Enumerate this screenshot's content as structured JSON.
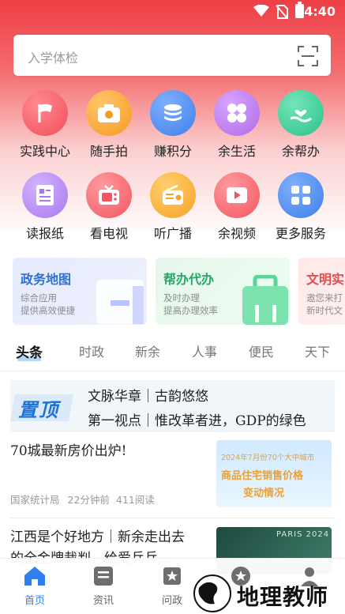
{
  "status_bar": {
    "time": "4:40"
  },
  "search": {
    "placeholder": "入学体检"
  },
  "grid": {
    "row1": [
      {
        "label": "实践中心",
        "icon": "flag-icon",
        "color": "#f24e5a"
      },
      {
        "label": "随手拍",
        "icon": "camera-icon",
        "color": "#f79a21"
      },
      {
        "label": "赚积分",
        "icon": "coins-icon",
        "color": "#3f7fe6"
      },
      {
        "label": "余生活",
        "icon": "clover-icon",
        "color": "#b06ae6"
      },
      {
        "label": "余帮办",
        "icon": "helping-hand-icon",
        "color": "#2cc28a"
      }
    ],
    "row2": [
      {
        "label": "读报纸",
        "icon": "newspaper-icon",
        "color": "#a879ee"
      },
      {
        "label": "看电视",
        "icon": "tv-icon",
        "color": "#f2565e"
      },
      {
        "label": "听广播",
        "icon": "radio-icon",
        "color": "#f6a226"
      },
      {
        "label": "余视频",
        "icon": "video-icon",
        "color": "#f2565e"
      },
      {
        "label": "更多服务",
        "icon": "apps-icon",
        "color": "#3f7fe6"
      }
    ]
  },
  "cards": [
    {
      "title": "政务地图",
      "sub1": "综合应用",
      "sub2": "提供高效便捷",
      "title_color": "#2f6fd6"
    },
    {
      "title": "帮办代办",
      "sub1": "及时办理",
      "sub2": "提高办理效率",
      "title_color": "#22a867"
    },
    {
      "title": "文明实",
      "sub1": "邀您来打",
      "sub2": "新时代文",
      "title_color": "#e24b4b"
    }
  ],
  "tabs": [
    "头条",
    "时政",
    "新余",
    "人事",
    "便民",
    "天下"
  ],
  "pinned": {
    "badge": "置顶",
    "lines": [
      "文脉华章｜古韵悠悠",
      "第一视点｜惟改革者进，GDP的绿色"
    ]
  },
  "news": [
    {
      "title": "70城最新房价出炉!",
      "source": "国家统计局",
      "time": "22分钟前",
      "reads": "411阅读",
      "thumb_caption1": "2024年7月份70个大中城市",
      "thumb_caption2": "商品住宅销售价格",
      "thumb_caption3": "变动情况"
    },
    {
      "title_line1": "江西是个好地方｜新余走出去",
      "title_line2": "的全金牌裁判，给爱乒乓...",
      "thumb_caption": "PARIS 2024"
    }
  ],
  "bottom_nav": [
    {
      "label": "首页",
      "icon": "home-icon",
      "active": true
    },
    {
      "label": "资讯",
      "icon": "news-icon",
      "active": false
    },
    {
      "label": "问政",
      "icon": "inquiry-icon",
      "active": false
    },
    {
      "label": "",
      "icon": "star-badge-icon",
      "active": false
    },
    {
      "label": "",
      "icon": "user-icon",
      "active": false
    }
  ],
  "watermark": {
    "text": "地理教师"
  },
  "colors": {
    "accent": "#2f7ff0",
    "brand_red": "#ee3f45"
  }
}
